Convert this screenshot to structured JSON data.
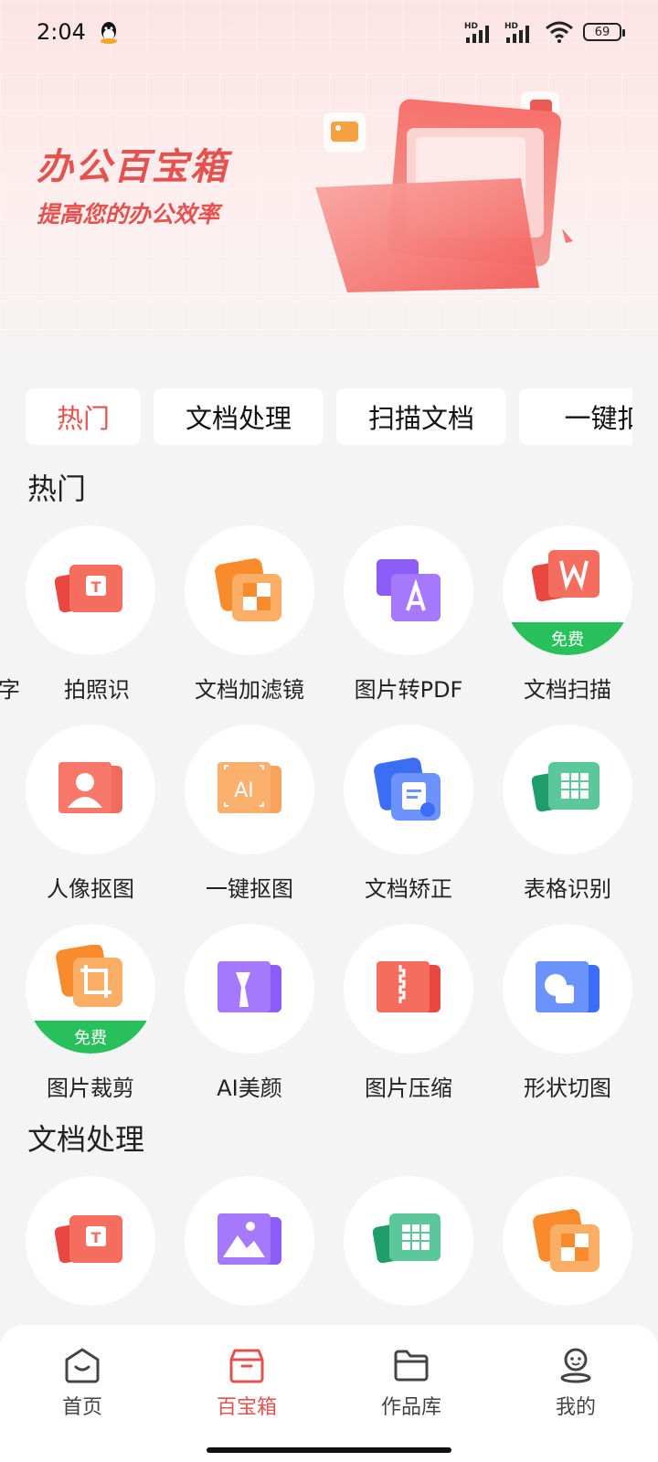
{
  "status_bar": {
    "time": "2:04",
    "signal_labels": [
      "HD",
      "HD"
    ],
    "battery": "69"
  },
  "hero": {
    "title": "办公百宝箱",
    "subtitle": "提高您的办公效率"
  },
  "tabs": [
    {
      "label": "热门",
      "active": true
    },
    {
      "label": "文档处理",
      "active": false
    },
    {
      "label": "扫描文档",
      "active": false
    },
    {
      "label": "一键扣",
      "active": false
    }
  ],
  "sections": {
    "hot": {
      "title": "热门",
      "items": [
        {
          "label": "字　　拍照识",
          "icon": "photo-text-recognize-icon",
          "badge": ""
        },
        {
          "label": "文档加滤镜",
          "icon": "document-filter-icon",
          "badge": ""
        },
        {
          "label": "图片转PDF",
          "icon": "image-to-pdf-icon",
          "badge": ""
        },
        {
          "label": "文档扫描",
          "icon": "document-scan-icon",
          "badge": "免费"
        },
        {
          "label": "人像抠图",
          "icon": "portrait-cutout-icon",
          "badge": ""
        },
        {
          "label": "一键抠图",
          "icon": "ai-cutout-icon",
          "badge": ""
        },
        {
          "label": "文档矫正",
          "icon": "document-correct-icon",
          "badge": ""
        },
        {
          "label": "表格识别",
          "icon": "table-recognize-icon",
          "badge": ""
        },
        {
          "label": "图片裁剪",
          "icon": "image-crop-icon",
          "badge": "免费"
        },
        {
          "label": "AI美颜",
          "icon": "ai-beauty-icon",
          "badge": ""
        },
        {
          "label": "图片压缩",
          "icon": "image-compress-icon",
          "badge": ""
        },
        {
          "label": "形状切图",
          "icon": "shape-cut-icon",
          "badge": ""
        }
      ]
    },
    "docs": {
      "title": "文档处理",
      "items": [
        {
          "icon": "text-recognize-icon"
        },
        {
          "icon": "image-icon"
        },
        {
          "icon": "table-icon"
        },
        {
          "icon": "document-filter-icon"
        }
      ]
    }
  },
  "bottom_nav": [
    {
      "label": "首页",
      "icon": "home-icon",
      "active": false
    },
    {
      "label": "百宝箱",
      "icon": "toolbox-icon",
      "active": true
    },
    {
      "label": "作品库",
      "icon": "folder-icon",
      "active": false
    },
    {
      "label": "我的",
      "icon": "profile-icon",
      "active": false
    }
  ],
  "colors": {
    "accent": "#e4524f",
    "free_badge": "#27c05a",
    "background": "#f4f4f4"
  }
}
